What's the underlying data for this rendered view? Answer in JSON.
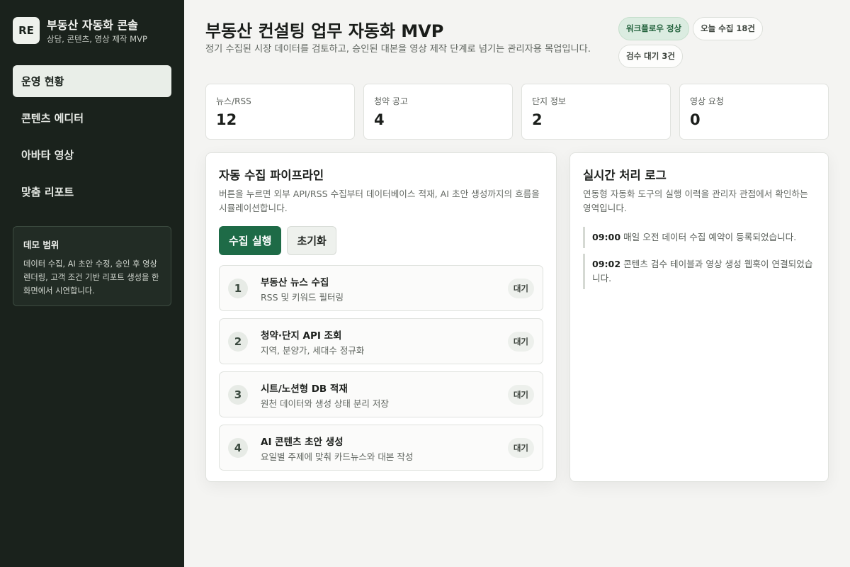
{
  "brand": {
    "logo": "RE",
    "title": "부동산 자동화 콘솔",
    "subtitle": "상담, 콘텐츠, 영상 제작 MVP"
  },
  "nav": [
    {
      "label": "운영 현황",
      "active": true
    },
    {
      "label": "콘텐츠 에디터",
      "active": false
    },
    {
      "label": "아바타 영상",
      "active": false
    },
    {
      "label": "맞춤 리포트",
      "active": false
    }
  ],
  "demo": {
    "title": "데모 범위",
    "text": "데이터 수집, AI 초안 수정, 승인 후 영상 렌더링, 고객 조건 기반 리포트 생성을 한 화면에서 시연합니다."
  },
  "header": {
    "title": "부동산 컨설팅 업무 자동화 MVP",
    "description": "정기 수집된 시장 데이터를 검토하고, 승인된 대본을 영상 제작 단계로 넘기는 관리자용 목업입니다."
  },
  "badges": [
    {
      "label": "워크플로우 정상",
      "status": "ok"
    },
    {
      "label": "오늘 수집 18건",
      "status": "neutral"
    },
    {
      "label": "검수 대기 3건",
      "status": "neutral"
    }
  ],
  "stats": [
    {
      "label": "뉴스/RSS",
      "value": "12"
    },
    {
      "label": "청약 공고",
      "value": "4"
    },
    {
      "label": "단지 정보",
      "value": "2"
    },
    {
      "label": "영상 요청",
      "value": "0"
    }
  ],
  "pipeline": {
    "title": "자동 수집 파이프라인",
    "description": "버튼을 누르면 외부 API/RSS 수집부터 데이터베이스 적재, AI 초안 생성까지의 흐름을 시뮬레이션합니다.",
    "run_label": "수집 실행",
    "reset_label": "초기화",
    "steps": [
      {
        "num": "1",
        "title": "부동산 뉴스 수집",
        "subtitle": "RSS 및 키워드 필터링",
        "status": "대기"
      },
      {
        "num": "2",
        "title": "청약·단지 API 조회",
        "subtitle": "지역, 분양가, 세대수 정규화",
        "status": "대기"
      },
      {
        "num": "3",
        "title": "시트/노션형 DB 적재",
        "subtitle": "원천 데이터와 생성 상태 분리 저장",
        "status": "대기"
      },
      {
        "num": "4",
        "title": "AI 콘텐츠 초안 생성",
        "subtitle": "요일별 주제에 맞춰 카드뉴스와 대본 작성",
        "status": "대기"
      }
    ]
  },
  "log": {
    "title": "실시간 처리 로그",
    "description": "연동형 자동화 도구의 실행 이력을 관리자 관점에서 확인하는 영역입니다.",
    "entries": [
      {
        "time": "09:00",
        "text": "매일 오전 데이터 수집 예약이 등록되었습니다."
      },
      {
        "time": "09:02",
        "text": "콘텐츠 검수 테이블과 영상 생성 웹훅이 연결되었습니다."
      }
    ]
  },
  "colors": {
    "sidebar_bg": "#1a221c",
    "accent": "#1e6b47",
    "ok_badge_bg": "#dbece1"
  }
}
